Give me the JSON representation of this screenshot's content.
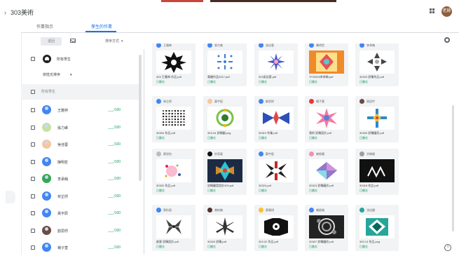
{
  "header": {
    "title": "303美術",
    "avatar_text": "老師"
  },
  "tabs": [
    {
      "label": "作業指示"
    },
    {
      "label": "學生的作業"
    }
  ],
  "toolbar": {
    "return_label": "退回",
    "sort_label": "排序方式"
  },
  "class_group": {
    "name": "所有學生",
    "select_label": "依姓氏排序"
  },
  "all_row_label": "所有學生",
  "students": [
    {
      "name": "王雅婷",
      "score": "___/100"
    },
    {
      "name": "張力維",
      "score": "___/100"
    },
    {
      "name": "吳佳蓉",
      "score": "___/100"
    },
    {
      "name": "陳明哲",
      "score": "___/100"
    },
    {
      "name": "李承翰",
      "score": "___/100"
    },
    {
      "name": "林芷妤",
      "score": "___/100"
    },
    {
      "name": "黃宇辰",
      "score": "___/100"
    },
    {
      "name": "劉思妤",
      "score": "___/100"
    },
    {
      "name": "楊子萱",
      "score": "___/100"
    }
  ],
  "cards": [
    {
      "name": "王雅婷",
      "file": "303 王雅婷-作品.pdf",
      "status": "已繳交",
      "theme": "bwstar"
    },
    {
      "name": "張力維",
      "file": "電繪作品0317.pdf",
      "status": "已繳交",
      "theme": "snow"
    },
    {
      "name": "吳佳蓉",
      "file": "303吳佳蓉.pdf",
      "status": "已繳交",
      "theme": "blueflake"
    },
    {
      "name": "陳明哲",
      "file": "7F03303李承翰.pdf",
      "status": "已繳交",
      "theme": "orange"
    },
    {
      "name": "李承翰",
      "file": "30323 對稱作品.pdf",
      "status": "已繳交",
      "theme": "greyarrow"
    },
    {
      "name": "林芷妤",
      "file": "30304 作品.pdf",
      "status": "已繳交",
      "theme": "dots"
    },
    {
      "name": "黃宇辰",
      "file": "303-04 對稱圖.png",
      "status": "已繳交",
      "theme": "greencircle"
    },
    {
      "name": "劉思妤",
      "file": "30319 作業.pdf",
      "status": "已繳交",
      "theme": "bowtie"
    },
    {
      "name": "楊子萱",
      "file": "我的 對稱設計.pdf",
      "status": "已繳交",
      "theme": "pinkstar"
    },
    {
      "name": "周冠宇",
      "file": "30326 對稱圖形.pdf",
      "status": "已繳交",
      "theme": "flake2"
    },
    {
      "name": "蔡欣怡",
      "file": "30302 作品.pdf",
      "status": "已繳交",
      "theme": "confetti"
    },
    {
      "name": "許家豪",
      "file": "對稱圖案設計303.pdf",
      "status": "已繳交",
      "theme": "teal"
    },
    {
      "name": "鄭宇庭",
      "file": "30324.pdf",
      "status": "已繳交",
      "theme": "redcross"
    },
    {
      "name": "謝佩珊",
      "file": "30315 對稱圖形.pdf",
      "status": "已繳交",
      "theme": "prism"
    },
    {
      "name": "洪偉倫",
      "file": "30318 作品.pdf",
      "status": "已繳交",
      "theme": "black"
    },
    {
      "name": "郭怡君",
      "file": "創意 對稱設計.pdf",
      "status": "已繳交",
      "theme": "greyleaf"
    },
    {
      "name": "曾柏翰",
      "file": "30329 對稱.pdf",
      "status": "已繳交",
      "theme": "bwsnow"
    },
    {
      "name": "廖雅琪",
      "file": "303 02 作品.pdf",
      "status": "已繳交",
      "theme": "blackmask"
    },
    {
      "name": "賴俊傑",
      "file": "30307 對稱圖形.pdf",
      "status": "已繳交",
      "theme": "circles"
    },
    {
      "name": "沈佳穎",
      "file": "303 13 作品.png",
      "status": "已繳交",
      "theme": "tealsq"
    }
  ]
}
